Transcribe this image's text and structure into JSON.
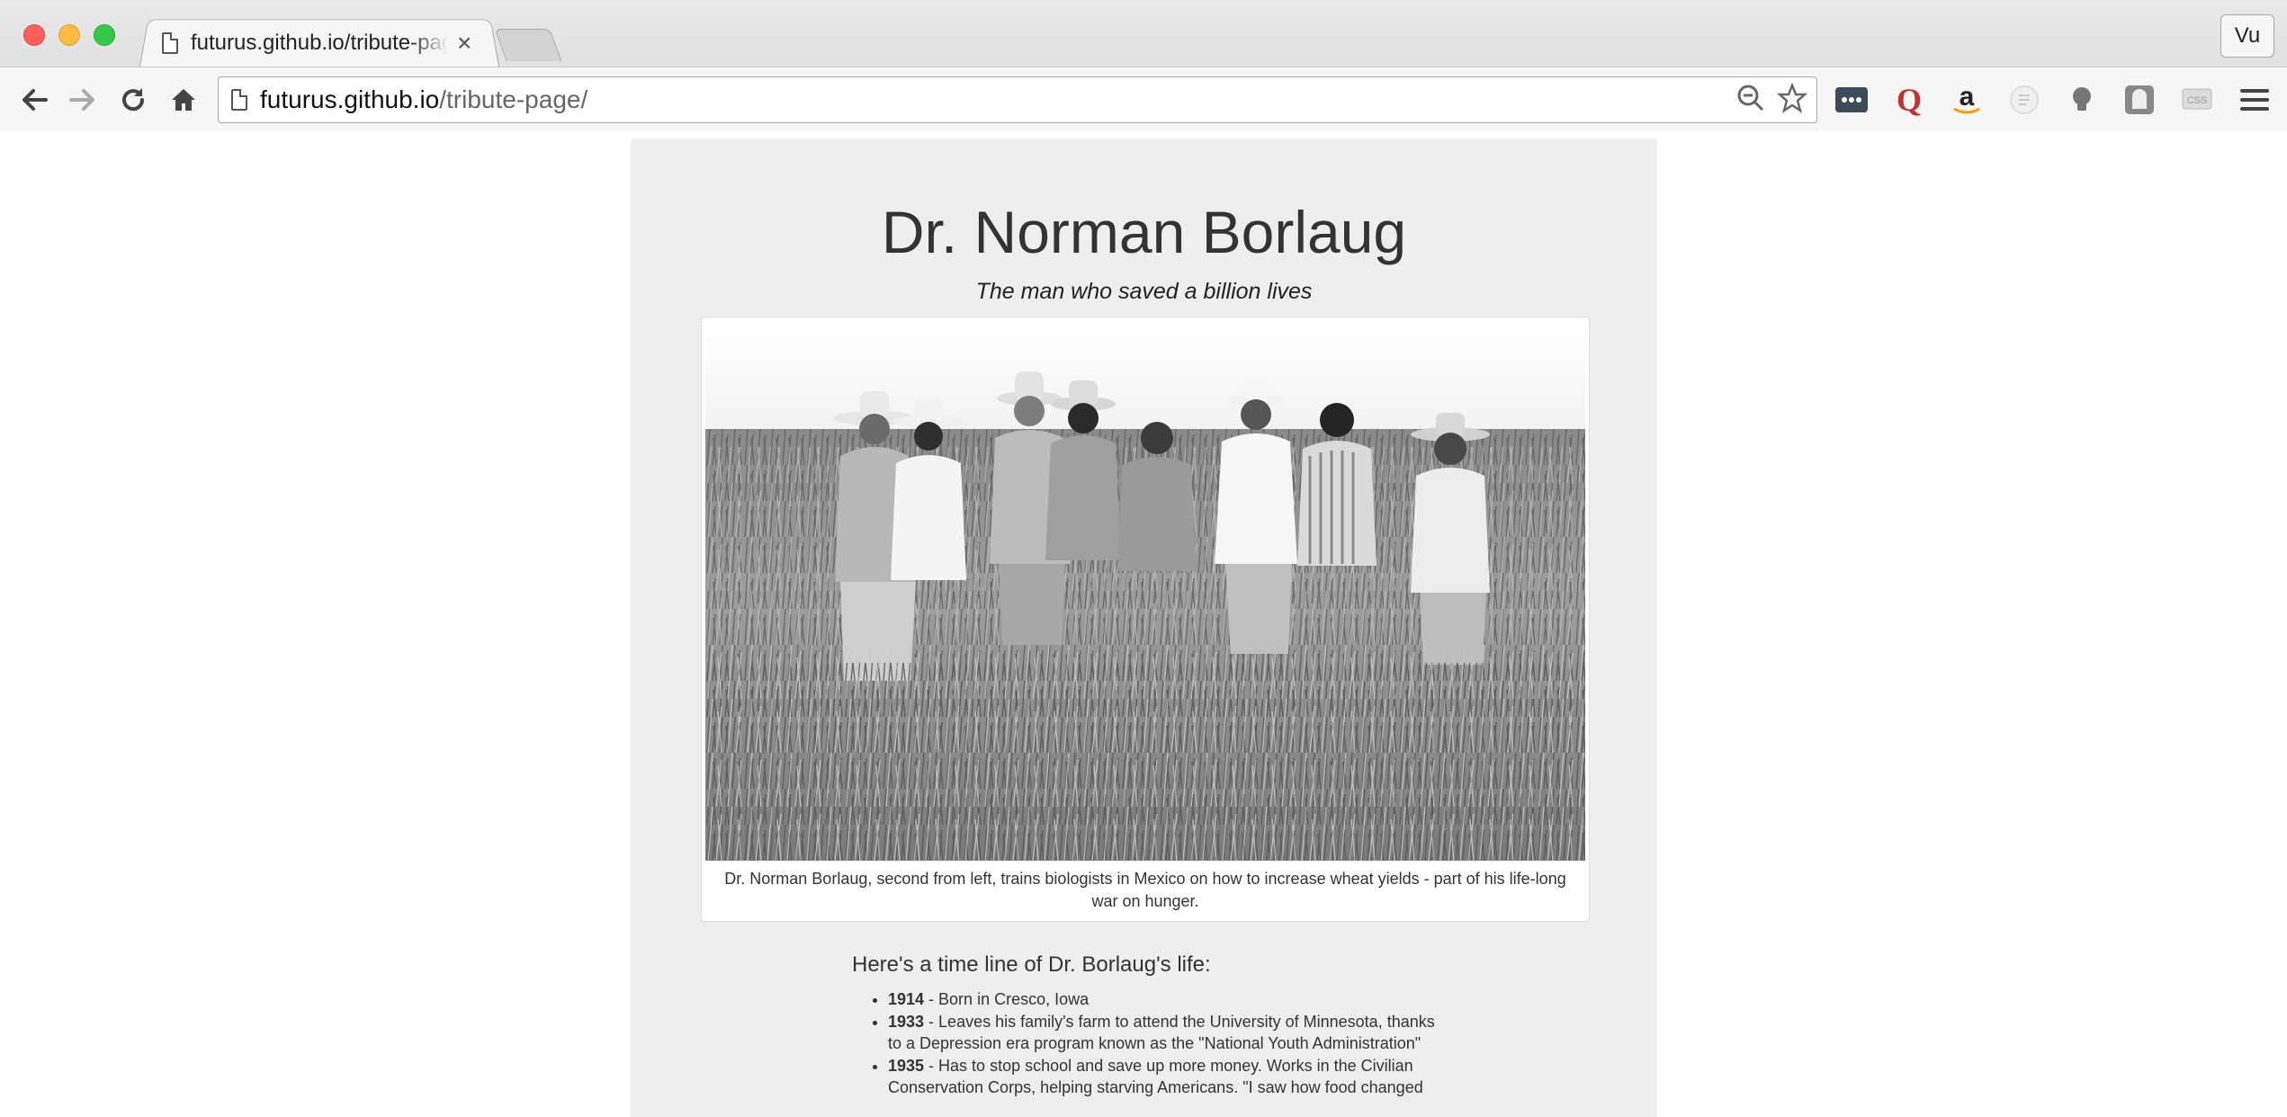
{
  "browser": {
    "tab_title": "futurus.github.io/tribute-page/",
    "tab_close": "×",
    "url_host": "futurus.github.io",
    "url_path": "/tribute-page/",
    "profile_name": "Vu",
    "extensions": [
      "password-manager-icon",
      "quora-icon",
      "amazon-icon",
      "reader-icon",
      "lightbulb-icon",
      "ghostery-icon",
      "css-viewer-icon"
    ]
  },
  "page": {
    "title": "Dr. Norman Borlaug",
    "subtitle": "The man who saved a billion lives",
    "image_caption": "Dr. Norman Borlaug, second from left, trains biologists in Mexico on how to increase wheat yields - part of his life-long war on hunger.",
    "timeline_heading": "Here's a time line of Dr. Borlaug's life:",
    "timeline": [
      {
        "year": "1914",
        "text": " - Born in Cresco, Iowa"
      },
      {
        "year": "1933",
        "text": " - Leaves his family's farm to attend the University of Minnesota, thanks to a Depression era program known as the \"National Youth Administration\""
      },
      {
        "year": "1935",
        "text": " - Has to stop school and save up more money. Works in the Civilian Conservation Corps, helping starving Americans. \"I saw how food changed"
      }
    ]
  }
}
